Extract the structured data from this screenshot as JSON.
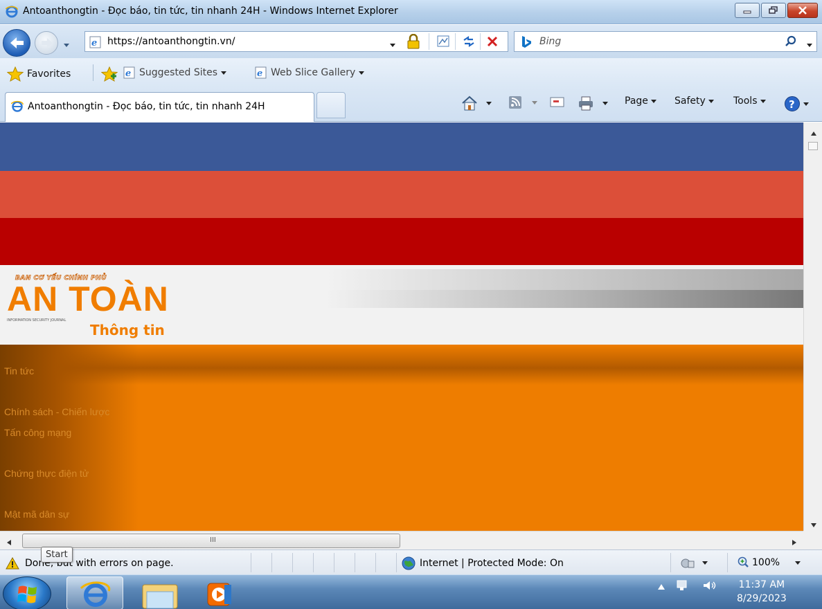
{
  "window": {
    "title": "Antoanthongtin - Đọc báo, tin tức, tin nhanh 24H - Windows Internet Explorer"
  },
  "address_bar": {
    "url": "https://antoanthongtin.vn/"
  },
  "search": {
    "placeholder": "Bing"
  },
  "favorites_bar": {
    "favorites_label": "Favorites",
    "items": [
      "Suggested Sites",
      "Web Slice Gallery"
    ]
  },
  "tabs": [
    {
      "label": "Antoanthongtin - Đọc báo, tin tức, tin nhanh 24H"
    }
  ],
  "command_bar": {
    "page_label": "Page",
    "safety_label": "Safety",
    "tools_label": "Tools"
  },
  "page": {
    "logo": {
      "top_line": "BAN CƠ YẾU CHÍNH PHỦ",
      "main": "AN TOÀN",
      "tiny": "INFORMATION SECURITY JOURNAL",
      "sub": "Thông tin"
    },
    "menu": [
      "Tin tức",
      "Chính sách - Chiến lược",
      "Tấn công mạng",
      "Chứng thực điện tử",
      "Mật mã dân sự"
    ],
    "colors": {
      "band_blue": "#3b5998",
      "band_coral": "#dc4f39",
      "band_red": "#b90000",
      "menu_orange": "#ee7d00"
    }
  },
  "scrollbar": {
    "grip": "III"
  },
  "status_bar": {
    "text": "Done, but with errors on page.",
    "zone": "Internet | Protected Mode: On",
    "zoom": "100%"
  },
  "tooltip": {
    "text": "Start"
  },
  "taskbar": {
    "time": "11:37 AM",
    "date": "8/29/2023"
  }
}
